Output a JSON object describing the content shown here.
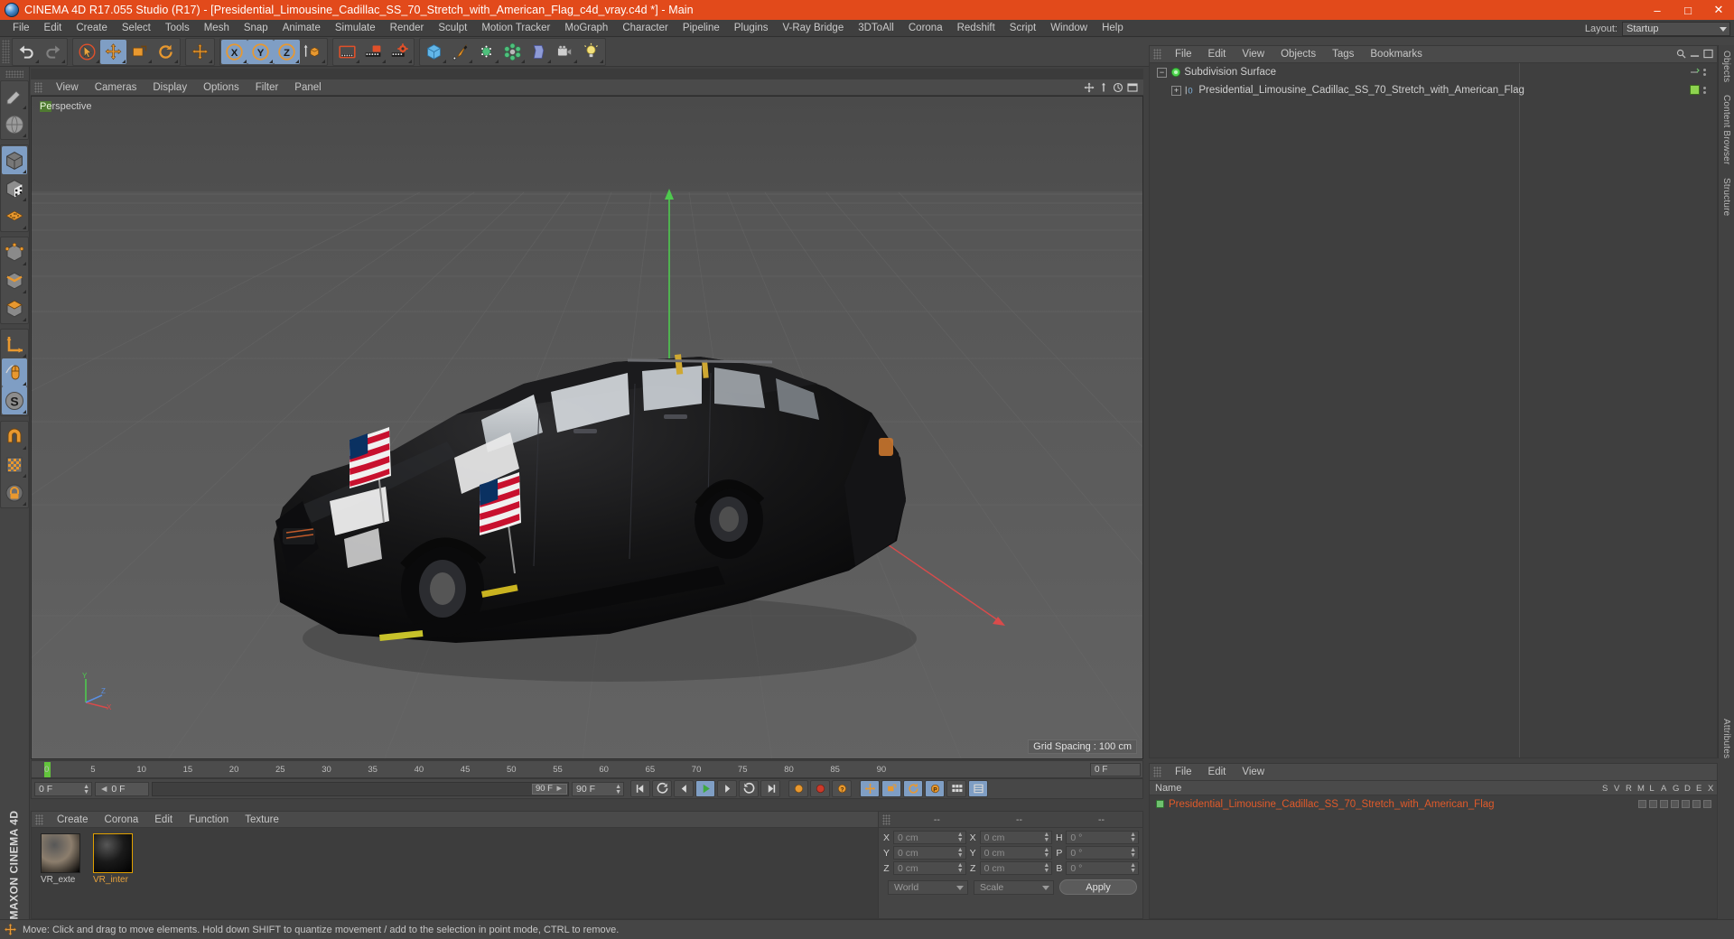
{
  "titlebar": {
    "app_icon": "cinema4d-logo-icon",
    "title": "CINEMA 4D R17.055 Studio (R17) - [Presidential_Limousine_Cadillac_SS_70_Stretch_with_American_Flag_c4d_vray.c4d *] - Main",
    "minimize": "–",
    "maximize": "□",
    "close": "✕",
    "accent": "#e24a1b"
  },
  "menubar": {
    "items": [
      "File",
      "Edit",
      "Create",
      "Select",
      "Tools",
      "Mesh",
      "Snap",
      "Animate",
      "Simulate",
      "Render",
      "Sculpt",
      "Motion Tracker",
      "MoGraph",
      "Character",
      "Pipeline",
      "Plugins",
      "V-Ray Bridge",
      "3DToAll",
      "Corona",
      "Redshift",
      "Script",
      "Window",
      "Help"
    ],
    "layout_label": "Layout:",
    "layout_value": "Startup"
  },
  "toolbar": {
    "groups": [
      {
        "name": "undo-redo",
        "buttons": [
          {
            "icon": "undo-icon",
            "label": "Undo",
            "active": false
          },
          {
            "icon": "redo-icon",
            "label": "Redo",
            "active": false
          }
        ]
      },
      {
        "name": "transform-tools",
        "buttons": [
          {
            "icon": "select-cursor-icon",
            "label": "Live Selection",
            "active": false
          },
          {
            "icon": "move-icon",
            "label": "Move",
            "active": true
          },
          {
            "icon": "scale-icon",
            "label": "Scale",
            "active": false
          },
          {
            "icon": "rotate-icon",
            "label": "Rotate",
            "active": false
          }
        ]
      },
      {
        "name": "world-axis",
        "buttons": [
          {
            "icon": "move-axis-icon",
            "label": "Move along axis",
            "active": false
          }
        ]
      },
      {
        "name": "axis-locks",
        "buttons": [
          {
            "icon": "axis-x-icon",
            "label": "X Axis",
            "active": true
          },
          {
            "icon": "axis-y-icon",
            "label": "Y Axis",
            "active": true
          },
          {
            "icon": "axis-z-icon",
            "label": "Z Axis",
            "active": true
          },
          {
            "icon": "world-object-coord-icon",
            "label": "World / Object coordinate system",
            "active": false
          }
        ]
      },
      {
        "name": "render-tools",
        "buttons": [
          {
            "icon": "render-view-icon",
            "label": "Render View",
            "active": false
          },
          {
            "icon": "render-picture-viewer-icon",
            "label": "Render to Picture Viewer",
            "active": false
          },
          {
            "icon": "render-settings-icon",
            "label": "Edit Render Settings",
            "active": false
          }
        ]
      },
      {
        "name": "create-objects",
        "buttons": [
          {
            "icon": "cube-primitive-icon",
            "label": "Add Cube Object",
            "active": false
          },
          {
            "icon": "spline-pen-icon",
            "label": "Spline Pen",
            "active": false
          },
          {
            "icon": "nurbs-icon",
            "label": "Add HyperNURBS",
            "active": false
          },
          {
            "icon": "array-icon",
            "label": "Add Array Object",
            "active": false
          },
          {
            "icon": "deformer-icon",
            "label": "Add Bend Object",
            "active": false
          },
          {
            "icon": "camera-icon",
            "label": "Add Camera",
            "active": false
          },
          {
            "icon": "light-icon",
            "label": "Add Light",
            "active": false
          }
        ]
      }
    ]
  },
  "leftbar": {
    "groups": [
      {
        "name": "modes-top",
        "buttons": [
          {
            "icon": "make-editable-icon",
            "label": "Make Editable",
            "active": false
          },
          {
            "icon": "texture-axis-icon",
            "label": "Texture Axis",
            "active": false
          }
        ]
      },
      {
        "name": "selection-modes",
        "buttons": [
          {
            "icon": "model-mode-icon",
            "label": "Model Mode",
            "active": true
          },
          {
            "icon": "texture-mode-icon",
            "label": "Texture Mode",
            "active": false
          },
          {
            "icon": "workplane-icon",
            "label": "Workplane",
            "active": false
          }
        ]
      },
      {
        "name": "component-modes",
        "buttons": [
          {
            "icon": "point-mode-icon",
            "label": "Points",
            "active": false
          },
          {
            "icon": "edge-mode-icon",
            "label": "Edges",
            "active": false
          },
          {
            "icon": "polygon-mode-icon",
            "label": "Polygons",
            "active": false
          }
        ]
      },
      {
        "name": "axis-tools",
        "buttons": [
          {
            "icon": "enable-axis-icon",
            "label": "Enable Axis Modification",
            "active": false
          },
          {
            "icon": "viewport-solo-icon",
            "label": "Viewport Solo",
            "active": true
          },
          {
            "icon": "snap-toggle-icon",
            "label": "Enable Snapping",
            "active": true
          }
        ]
      },
      {
        "name": "magnet-group",
        "buttons": [
          {
            "icon": "magnet-icon",
            "label": "Magnet",
            "active": false
          },
          {
            "icon": "lock-axis-icon",
            "label": "Lock Axis",
            "active": false
          },
          {
            "icon": "quantize-icon",
            "label": "Quantize",
            "active": false
          }
        ]
      }
    ],
    "brand": "MAXON CINEMA 4D"
  },
  "viewport": {
    "menu": [
      "View",
      "Cameras",
      "Display",
      "Options",
      "Filter",
      "Panel"
    ],
    "label_prefix": "Pe",
    "label_rest": "rspective",
    "grid_spacing": "Grid Spacing : 100 cm",
    "nav_icons": [
      "move-camera-icon",
      "pan-camera-icon",
      "orbit-camera-icon",
      "maximize-viewport-icon"
    ],
    "scene_description": "Black Presidential Cadillac limousine with two American flags on hood, perspective view on grey grid floor"
  },
  "timeline": {
    "ticks": [
      "0",
      "5",
      "10",
      "15",
      "20",
      "25",
      "30",
      "35",
      "40",
      "45",
      "50",
      "55",
      "60",
      "65",
      "70",
      "75",
      "80",
      "85",
      "90"
    ],
    "end_field": "0 F",
    "current_frame": "0 F",
    "start_frame": "0 F",
    "slider_label": "90 F",
    "max_frame": "90 F",
    "transport": [
      {
        "icon": "goto-start-icon",
        "label": "Go to Start",
        "active": false
      },
      {
        "icon": "step-back-key-icon",
        "label": "Go to Previous Key",
        "active": false
      },
      {
        "icon": "step-back-icon",
        "label": "Go to Previous Frame",
        "active": false
      },
      {
        "icon": "play-icon",
        "label": "Play Forwards",
        "active": true
      },
      {
        "icon": "step-forward-icon",
        "label": "Go to Next Frame",
        "active": false
      },
      {
        "icon": "step-forward-key-icon",
        "label": "Go to Next Key",
        "active": false
      },
      {
        "icon": "goto-end-icon",
        "label": "Go to End",
        "active": false
      }
    ],
    "record_tools": [
      {
        "icon": "record-active-objects-icon",
        "label": "Record Active Objects",
        "active": false
      },
      {
        "icon": "autokeying-icon",
        "label": "Autokeying",
        "active": false
      },
      {
        "icon": "keyframe-selection-icon",
        "label": "Keyframe Selection",
        "active": false
      }
    ],
    "param_tools": [
      {
        "icon": "position-key-icon",
        "label": "Position",
        "active": true
      },
      {
        "icon": "scale-key-icon",
        "label": "Scale",
        "active": true
      },
      {
        "icon": "rotation-key-icon",
        "label": "Rotation",
        "active": true
      },
      {
        "icon": "pla-key-icon",
        "label": "Point Level Animation",
        "active": true
      },
      {
        "icon": "dope-sheet-icon",
        "label": "Animation Mode",
        "active": false
      },
      {
        "icon": "timeline-panel-icon",
        "label": "Timeline",
        "active": true
      }
    ]
  },
  "materials": {
    "menu": [
      "Create",
      "Corona",
      "Edit",
      "Function",
      "Texture"
    ],
    "items": [
      {
        "name": "VR_exte",
        "swatch": "#8c7e6d",
        "kind": "sphere-preview"
      },
      {
        "name": "VR_inter",
        "swatch": "#1a1a1a",
        "kind": "sphere-preview",
        "selected": true
      }
    ]
  },
  "coordinates": {
    "headers": [
      "--",
      "--",
      "--"
    ],
    "rows": [
      {
        "label_pos": "X",
        "pos": "0 cm",
        "label_size": "X",
        "size": "0 cm",
        "label_rot": "H",
        "rot": "0 °"
      },
      {
        "label_pos": "Y",
        "pos": "0 cm",
        "label_size": "Y",
        "size": "0 cm",
        "label_rot": "P",
        "rot": "0 °"
      },
      {
        "label_pos": "Z",
        "pos": "0 cm",
        "label_size": "Z",
        "size": "0 cm",
        "label_rot": "B",
        "rot": "0 °"
      }
    ],
    "system": "World",
    "mode": "Scale",
    "apply": "Apply"
  },
  "object_manager": {
    "menu": [
      "File",
      "Edit",
      "View",
      "Objects",
      "Tags",
      "Bookmarks"
    ],
    "search_icon": "search-icon",
    "tree": [
      {
        "name": "Subdivision Surface",
        "icon": "subdivision-surface-icon",
        "depth": 0,
        "expander": "−",
        "has_green": false
      },
      {
        "name": "Presidential_Limousine_Cadillac_SS_70_Stretch_with_American_Flag",
        "icon": "null-object-icon",
        "depth": 1,
        "expander": "+",
        "has_green": true
      }
    ]
  },
  "vertical_tabs": [
    "Objects",
    "Content Browser",
    "Structure"
  ],
  "attribute_manager": {
    "menu": [
      "File",
      "Edit",
      "View"
    ],
    "column_header": "Name",
    "columns": [
      "S",
      "V",
      "R",
      "M",
      "L",
      "A",
      "G",
      "D",
      "E",
      "X"
    ],
    "rows": [
      {
        "name": "Presidential_Limousine_Cadillac_SS_70_Stretch_with_American_Flag",
        "icon": "null-object-icon"
      }
    ],
    "side_tab": "Attributes"
  },
  "statusbar": {
    "icon": "move-tool-icon",
    "text": "Move: Click and drag to move elements. Hold down SHIFT to quantize movement / add to the selection in point mode, CTRL to remove."
  }
}
